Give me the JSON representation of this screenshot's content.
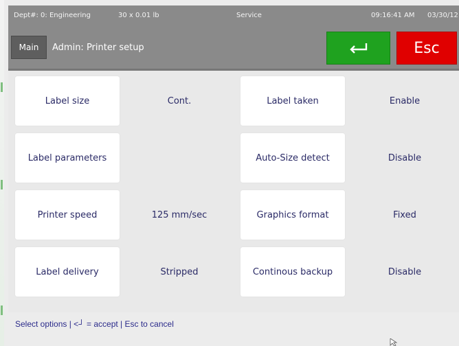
{
  "status_bar": {
    "dept": "Dept#: 0: Engineering",
    "scale": "30 x 0.01 lb",
    "mode": "Service",
    "time": "09:16:41 AM",
    "date": "03/30/12"
  },
  "header": {
    "main_label": "Main",
    "title": "Admin: Printer setup",
    "enter_icon": "enter-arrow-icon",
    "esc_label": "Esc",
    "colors": {
      "enter": "#1fa21f",
      "esc": "#e00000",
      "bar": "#8a8a8a"
    }
  },
  "options_left": [
    {
      "label": "Label size",
      "value": "Cont."
    },
    {
      "label": "Label parameters",
      "value": ""
    },
    {
      "label": "Printer speed",
      "value": "125  mm/sec"
    },
    {
      "label": "Label delivery",
      "value": "Stripped"
    }
  ],
  "options_right": [
    {
      "label": "Label taken",
      "value": "Enable"
    },
    {
      "label": "Auto-Size detect",
      "value": "Disable"
    },
    {
      "label": "Graphics format",
      "value": "Fixed"
    },
    {
      "label": "Continous backup",
      "value": "Disable"
    }
  ],
  "footer": {
    "hint": "Select options | <┘ = accept | Esc to cancel"
  }
}
